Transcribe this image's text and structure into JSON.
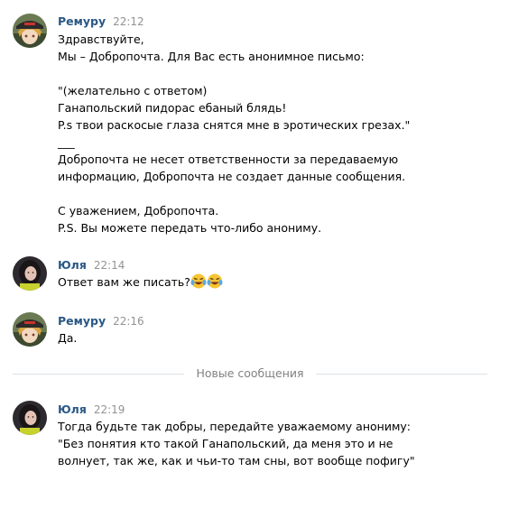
{
  "messages": [
    {
      "author": "Ремуру",
      "time": "22:12",
      "avatar_icon": "anime-avatar-icon",
      "lines": [
        "Здравствуйте,",
        "Мы – Добропочта. Для Вас есть анонимное письмо:",
        "",
        "\"(желательно с ответом)",
        "Ганапольский пидорас ебаный блядь!",
        "P.s твои раскосые глаза снятся мне в эротических грезах.\"",
        "___",
        "Добропочта не несет ответственности за передаваемую",
        "информацию, Добропочта не создает данные сообщения.",
        "",
        "С уважением, Добропочта.",
        "P.S. Вы можете передать что-либо анониму."
      ]
    },
    {
      "author": "Юля",
      "time": "22:14",
      "avatar_icon": "user-photo-avatar-icon",
      "lines": [
        "Ответ вам же писать?"
      ],
      "emoji": [
        "tears-of-joy-emoji",
        "tears-of-joy-emoji"
      ]
    },
    {
      "author": "Ремуру",
      "time": "22:16",
      "avatar_icon": "anime-avatar-icon",
      "lines": [
        "Да."
      ]
    },
    {
      "author": "Юля",
      "time": "22:19",
      "avatar_icon": "user-photo-avatar-icon",
      "lines": [
        "Тогда будьте так добры, передайте уважаемому анониму:",
        "\"Без понятия кто такой Ганапольский, да меня это и не",
        "волнует, так же, как и чьи-то там сны, вот вообще пофигу\""
      ]
    }
  ],
  "divider": {
    "label": "Новые сообщения"
  },
  "colors": {
    "author": "#2a5885",
    "time": "#939393",
    "divider_line": "#dce1e6",
    "divider_text": "#828282"
  }
}
